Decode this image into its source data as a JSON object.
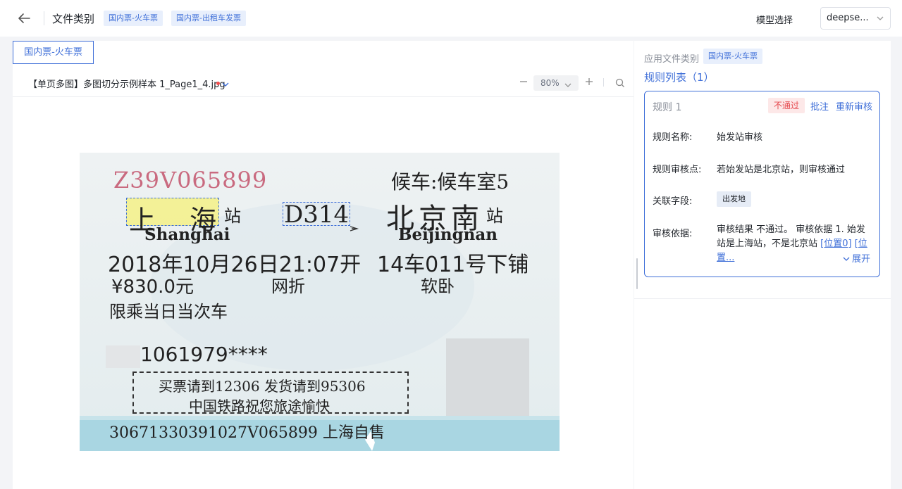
{
  "header": {
    "title": "文件类别",
    "category_tags": [
      "国内票-火车票",
      "国内票-出租车发票"
    ],
    "model_label": "模型选择",
    "model_value": "deepse..."
  },
  "viewer": {
    "active_tab": "国内票-火车票",
    "file_name": "【单页多图】多图切分示例样本 1_Page1_4.jpg",
    "zoom": "80%"
  },
  "ticket": {
    "serial": "Z39V065899",
    "waiting_room": "候车:候车室5",
    "from_station": "上海",
    "station_suffix": "站",
    "train_no": "D314",
    "to_station": "北京南",
    "from_en": "Shanghai",
    "to_en": "Beijingnan",
    "datetime": "2018年10月26日21:07开",
    "seat": "14车011号下铺",
    "price": "¥830.0元",
    "discount": "网折",
    "class": "软卧",
    "limit": "限乘当日当次车",
    "id_no": "1061979****",
    "notice_1": "买票请到12306 发货请到95306",
    "notice_2": "中国铁路祝您旅途愉快",
    "bottom_code": "30671330391027V065899 上海自售"
  },
  "rules_panel": {
    "apply_label": "应用文件类别",
    "apply_tag": "国内票-火车票",
    "list_title": "规则列表（1）",
    "rule": {
      "name": "规则 1",
      "status": "不通过",
      "annotate": "批注",
      "reaudit": "重新审核",
      "name_label": "规则名称:",
      "name_value": "始发站审核",
      "point_label": "规则审核点:",
      "point_value": "若始发站是北京站，则审核通过",
      "field_label": "关联字段:",
      "field_value": "出发地",
      "basis_label": "审核依据:",
      "basis_text": "审核结果 不通过。 审核依据 1. 始发站是上海站，不是北京站",
      "loc_1": "[位置0]",
      "loc_2": "[位置...",
      "expand": "展开"
    }
  },
  "colors": {
    "accent": "#3f6fd8",
    "fail_red": "#e5484d",
    "tag_bg": "#e8effc",
    "highlight": "#f6f078"
  },
  "icons": [
    "back-arrow-icon",
    "chevron-down-icon",
    "minus-icon",
    "plus-icon",
    "search-icon"
  ]
}
